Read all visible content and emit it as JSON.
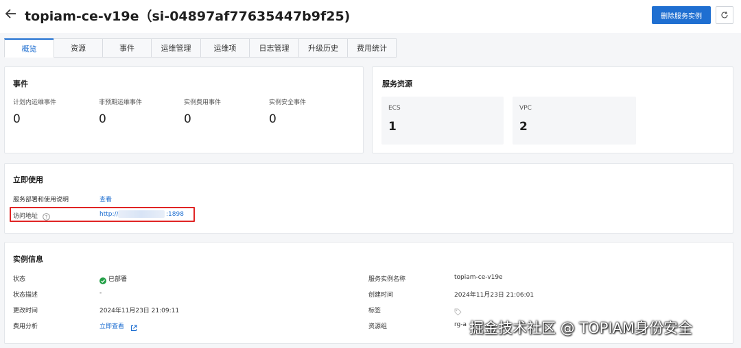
{
  "header": {
    "title": "topiam-ce-v19e（si-04897af77635447b9f25)",
    "delete_label": "删除服务实例"
  },
  "tabs": [
    {
      "label": "概览",
      "active": true
    },
    {
      "label": "资源"
    },
    {
      "label": "事件"
    },
    {
      "label": "运维管理"
    },
    {
      "label": "运维项"
    },
    {
      "label": "日志管理"
    },
    {
      "label": "升级历史"
    },
    {
      "label": "费用统计"
    }
  ],
  "events_card": {
    "title": "事件",
    "items": [
      {
        "label": "计划内运维事件",
        "value": "0"
      },
      {
        "label": "非预期运维事件",
        "value": "0"
      },
      {
        "label": "实例费用事件",
        "value": "0"
      },
      {
        "label": "实例安全事件",
        "value": "0"
      }
    ]
  },
  "resources_card": {
    "title": "服务资源",
    "items": [
      {
        "label": "ECS",
        "value": "1"
      },
      {
        "label": "VPC",
        "value": "2"
      }
    ]
  },
  "usage_card": {
    "title": "立即使用",
    "doc_label": "服务部署和使用说明",
    "doc_link": "查看",
    "access_label": "访问地址",
    "access_url_prefix": "http://",
    "access_url_suffix": ":1898"
  },
  "instance_card": {
    "title": "实例信息",
    "left": [
      {
        "label": "状态",
        "value": "已部署"
      },
      {
        "label": "状态描述",
        "value": "-"
      },
      {
        "label": "更改时间",
        "value": "2024年11月23日 21:09:11"
      },
      {
        "label": "费用分析",
        "value": "立即查看"
      }
    ],
    "right": [
      {
        "label": "服务实例名称",
        "value": "topiam-ce-v19e"
      },
      {
        "label": "创建时间",
        "value": "2024年11月23日 21:06:01"
      },
      {
        "label": "标签",
        "value": ""
      },
      {
        "label": "资源组",
        "value": "rg-a"
      }
    ]
  },
  "watermark": "掘金技术社区 @ TOPIAM身份安全",
  "colors": {
    "accent": "#1f6fd1",
    "success": "#23a047",
    "highlight": "#e02424",
    "background": "#f5f6f8"
  }
}
